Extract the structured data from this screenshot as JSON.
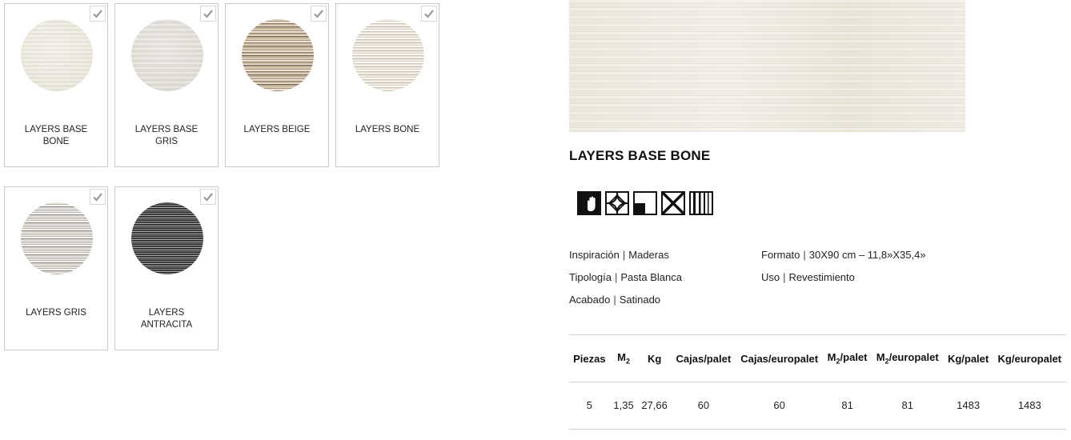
{
  "swatches": [
    {
      "name_line1": "LAYERS BASE",
      "name_line2": "BONE",
      "texture": "base-bone"
    },
    {
      "name_line1": "LAYERS BASE",
      "name_line2": "GRIS",
      "texture": "base-gris"
    },
    {
      "name_line1": "LAYERS BEIGE",
      "name_line2": "",
      "texture": "beige"
    },
    {
      "name_line1": "LAYERS BONE",
      "name_line2": "",
      "texture": "bone"
    },
    {
      "name_line1": "LAYERS GRIS",
      "name_line2": "",
      "texture": "gris"
    },
    {
      "name_line1": "LAYERS",
      "name_line2": "ANTRACITA",
      "texture": "antracita"
    }
  ],
  "product": {
    "title": "LAYERS BASE BONE",
    "feature_icons": [
      "wall-hand-icon",
      "star-diamond-icon",
      "corner-square-icon",
      "x-cross-icon",
      "vertical-stripes-icon"
    ]
  },
  "specs": {
    "inspiracion_label": "Inspiración",
    "inspiracion_value": "Maderas",
    "tipologia_label": "Tipología",
    "tipologia_value": "Pasta Blanca",
    "acabado_label": "Acabado",
    "acabado_value": "Satinado",
    "formato_label": "Formato",
    "formato_value": "30X90 cm – 11,8»X35,4»",
    "uso_label": "Uso",
    "uso_value": "Revestimiento",
    "separator": "|"
  },
  "table": {
    "headers": {
      "piezas": "Piezas",
      "m2_base": "M",
      "m2_sub": "2",
      "kg": "Kg",
      "cajas_palet": "Cajas/palet",
      "cajas_europalet": "Cajas/europalet",
      "m2palet_base": "M",
      "m2palet_sub": "2",
      "m2palet_rest": "/palet",
      "m2euro_base": "M",
      "m2euro_sub": "2",
      "m2euro_rest": "/europalet",
      "kg_palet": "Kg/palet",
      "kg_europalet": "Kg/europalet"
    },
    "row": {
      "piezas": "5",
      "m2": "1,35",
      "kg": "27,66",
      "cajas_palet": "60",
      "cajas_europalet": "60",
      "m2_palet": "81",
      "m2_europalet": "81",
      "kg_palet": "1483",
      "kg_europalet": "1483"
    }
  }
}
